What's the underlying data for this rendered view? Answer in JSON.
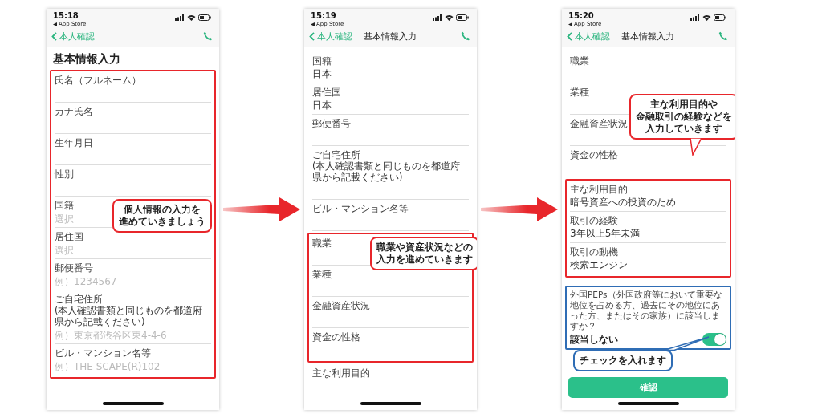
{
  "screens": [
    {
      "time": "15:18",
      "back_app": "App Store",
      "back_label": "本人確認",
      "page_title": "基本情報入力",
      "blocks": [
        {
          "kind": "fields",
          "highlighted": true,
          "color": "#e8262b",
          "fields": [
            {
              "kind": "input",
              "label": "氏名（フルネーム）"
            },
            {
              "kind": "input",
              "label": "カナ氏名"
            },
            {
              "kind": "input",
              "label": "生年月日"
            },
            {
              "kind": "input",
              "label": "性別"
            },
            {
              "kind": "input",
              "label": "国籍",
              "placeholder": "選択",
              "callout": {
                "lines": [
                  "個人情報の入力を",
                  "進めていきましょう"
                ],
                "color": "#e8262b"
              }
            },
            {
              "kind": "input",
              "label": "居住国",
              "placeholder": "選択"
            },
            {
              "kind": "input",
              "label": "郵便番号",
              "placeholder": "例）1234567"
            },
            {
              "kind": "input",
              "label": "ご自宅住所",
              "note": "(本人確認書類と同じものを都道府県から記載ください)",
              "placeholder": "例）東京都渋谷区東4-4-6"
            },
            {
              "kind": "input",
              "label": "ビル・マンション名等",
              "placeholder": "例）THE SCAPE(R)102"
            }
          ]
        }
      ]
    },
    {
      "time": "15:19",
      "back_app": "App Store",
      "back_label": "本人確認",
      "nav_title": "基本情報入力",
      "blocks": [
        {
          "kind": "fields",
          "highlighted": false,
          "fields": [
            {
              "kind": "input",
              "label": "国籍",
              "value": "日本"
            },
            {
              "kind": "input",
              "label": "居住国",
              "value": "日本"
            },
            {
              "kind": "input",
              "label": "郵便番号"
            },
            {
              "kind": "input",
              "label": "ご自宅住所",
              "note": "(本人確認書類と同じものを都道府県から記載ください)"
            },
            {
              "kind": "input",
              "label": "ビル・マンション名等"
            }
          ]
        },
        {
          "kind": "fields",
          "highlighted": true,
          "color": "#e8262b",
          "fields": [
            {
              "kind": "input",
              "label": "職業",
              "callout": {
                "lines": [
                  "職業や資産状況などの",
                  "入力を進めていきます"
                ],
                "color": "#e8262b"
              }
            },
            {
              "kind": "input",
              "label": "業種"
            },
            {
              "kind": "input",
              "label": "金融資産状況"
            },
            {
              "kind": "input",
              "label": "資金の性格"
            }
          ]
        },
        {
          "kind": "fields",
          "highlighted": false,
          "fields": [
            {
              "kind": "label",
              "label": "主な利用目的"
            }
          ]
        }
      ]
    },
    {
      "time": "15:20",
      "back_app": "App Store",
      "back_label": "本人確認",
      "nav_title": "基本情報入力",
      "blocks": [
        {
          "kind": "fields",
          "highlighted": false,
          "fields": [
            {
              "kind": "input",
              "label": "職業"
            },
            {
              "kind": "input",
              "label": "業種"
            },
            {
              "kind": "input",
              "label": "金融資産状況",
              "callout": {
                "lines": [
                  "主な利用目的や",
                  "金融取引の経験などを",
                  "入力していきます"
                ],
                "color": "#e8262b",
                "pointer": true
              }
            },
            {
              "kind": "input",
              "label": "資金の性格"
            }
          ]
        },
        {
          "kind": "fields",
          "highlighted": true,
          "color": "#e8262b",
          "fields": [
            {
              "kind": "input",
              "label": "主な利用目的",
              "value": "暗号資産への投資のため"
            },
            {
              "kind": "input",
              "label": "取引の経験",
              "value": "3年以上5年未満"
            },
            {
              "kind": "input",
              "label": "取引の動機",
              "value": "検索エンジン"
            }
          ]
        },
        {
          "kind": "question",
          "highlighted": true,
          "color": "#2f6db5",
          "text": "外国PEPs（外国政府等において重要な地位を占める方、過去にその地位にあった方、またはその家族）に該当しますか？",
          "answer": "該当しない",
          "on": true,
          "callout": {
            "lines": [
              "チェックを入れます"
            ],
            "color": "#2f6db5",
            "pointer": true
          }
        },
        {
          "kind": "button",
          "label": "確認"
        }
      ]
    }
  ]
}
